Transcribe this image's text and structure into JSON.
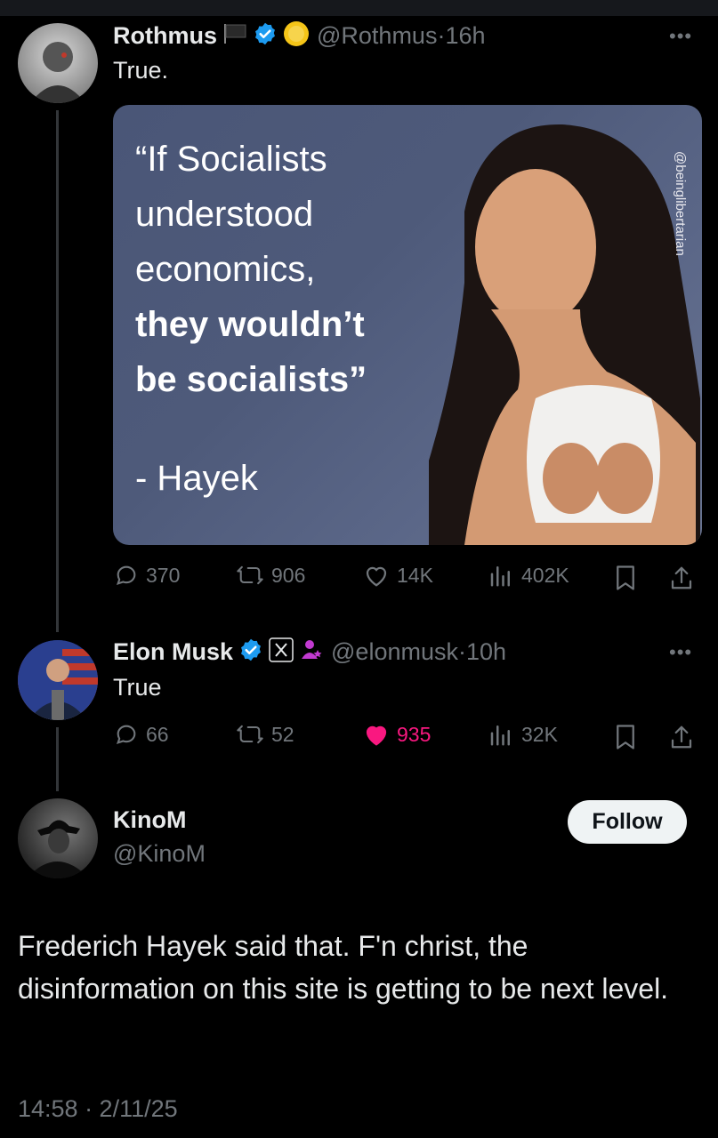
{
  "tweet1": {
    "name": "Rothmus",
    "handle": "@Rothmus",
    "time": "16h",
    "text": "True.",
    "media": {
      "quote_line1": "“If Socialists",
      "quote_line2": "understood",
      "quote_line3": "economics,",
      "quote_line4": "they wouldn’t",
      "quote_line5": "be socialists”",
      "attribution": "- Hayek",
      "watermark": "@beinglibertarian"
    },
    "replies": "370",
    "reposts": "906",
    "likes": "14K",
    "views": "402K"
  },
  "tweet2": {
    "name": "Elon Musk",
    "handle": "@elonmusk",
    "time": "10h",
    "text": "True",
    "replies": "66",
    "reposts": "52",
    "likes": "935",
    "views": "32K"
  },
  "main_tweet": {
    "name": "KinoM",
    "handle": "@KinoM",
    "follow_label": "Follow",
    "text": "Frederich Hayek said that. F'n christ, the disinformation on this site is getting to be next level.",
    "timestamp": "14:58 · 2/11/25"
  },
  "colors": {
    "verified": "#1d9bf0",
    "liked": "#f91880",
    "muted": "#71767b"
  },
  "icons": [
    "reply-icon",
    "repost-icon",
    "like-icon",
    "views-icon",
    "bookmark-icon",
    "share-icon",
    "verified-icon",
    "more-icon"
  ]
}
